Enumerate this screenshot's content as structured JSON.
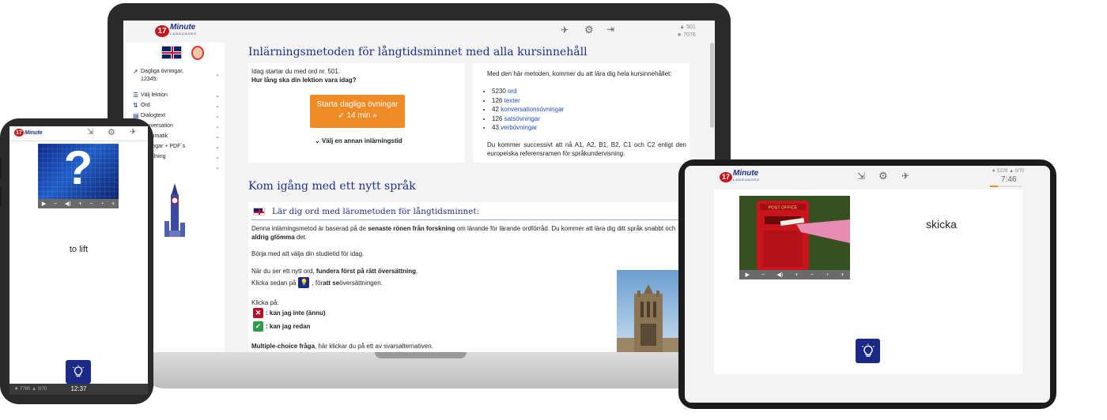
{
  "brand": {
    "logo_number": "17",
    "logo_word": "Minute",
    "logo_sub": "LANGUAGES",
    "accent": "#1f2f86",
    "orange": "#f08a24",
    "red": "#c4161c"
  },
  "laptop": {
    "stats": {
      "words": "501",
      "stars": "7076"
    },
    "sidebar": {
      "daily_label": "Dagliga övningar,",
      "daily_count": "12345:",
      "items": [
        {
          "label": "Välj lektion",
          "icon": "list-icon"
        },
        {
          "label": "Ord",
          "icon": "words-icon"
        },
        {
          "label": "Dialogtext",
          "icon": "book-icon"
        },
        {
          "label": "Konversation",
          "icon": "chat-icon"
        },
        {
          "label": "Grammatik",
          "icon": "grammar-icon"
        },
        {
          "label": "Övningar + PDF´s",
          "icon": "pdf-icon"
        },
        {
          "label": "Inställning",
          "icon": "gear-icon"
        },
        {
          "label": "",
          "icon": "more-icon"
        }
      ]
    },
    "main": {
      "title": "Inlärningsmetoden för långtidsminnet med alla kursinnehåll",
      "left_card": {
        "line1": "Idag startar du med ord nr. 501.",
        "line2": "Hur lång ska din lektion vara idag?",
        "start_button": "Starta dagliga övningar",
        "start_duration": "14 min",
        "choose_time": "Välj en annan inlärningstid"
      },
      "right_card": {
        "intro": "Med den här metoden, kommer du att lära dig hela kursinnehållet:",
        "items": [
          {
            "count": "5230",
            "label": "ord"
          },
          {
            "count": "126",
            "label": "texter"
          },
          {
            "count": "42",
            "label": "konversationsövningar"
          },
          {
            "count": "126",
            "label": "satsövningar"
          },
          {
            "count": "43",
            "label": "verbövningar"
          }
        ],
        "outro": "Du kommer successivt att nå A1, A2, B1, B2, C1 och C2 enligt den europeiska referensramen för språkundervisning."
      },
      "section2_title": "Kom igång med ett nytt språk",
      "subsection_title": "Lär dig ord med lärometoden för långtidsminnet:",
      "para1_a": "Denna inlärningsmetod är baserad på de ",
      "para1_b": "senaste rönen från forskning",
      "para1_c": " om lärande för lärande ordförråd. Du kommer att lära dig ditt språk snabbt och ",
      "para1_d": "aldrig glömma",
      "para1_e": " det.",
      "para2": "Börja med att välja din studietid för idag.",
      "para3_a": "När du ser ett nytt ord, ",
      "para3_b": "fundera först på rätt översättning",
      "para3_c": ".",
      "para4_a": "Klicka sedan på ",
      "para4_b": ", för ",
      "para4_c": "att se",
      "para4_d": " översättningen.",
      "click_label": "Klicka på:",
      "not_yet": ": kan jag inte (ännu)",
      "know_it": ": kan jag redan",
      "mc_a": "Multiple-choice fråga",
      "mc_b": ", här klickar du på ett av svarsalternativen."
    }
  },
  "phone": {
    "word": "to lift",
    "question_mark": "?",
    "time": "12:37",
    "stats": {
      "stars": "7780",
      "words": "0/70"
    }
  },
  "tablet": {
    "word": "skicka",
    "time": "7:46",
    "stats": {
      "stars": "5229",
      "words": "0/70"
    },
    "photo_caption": "POST OFFICE"
  }
}
